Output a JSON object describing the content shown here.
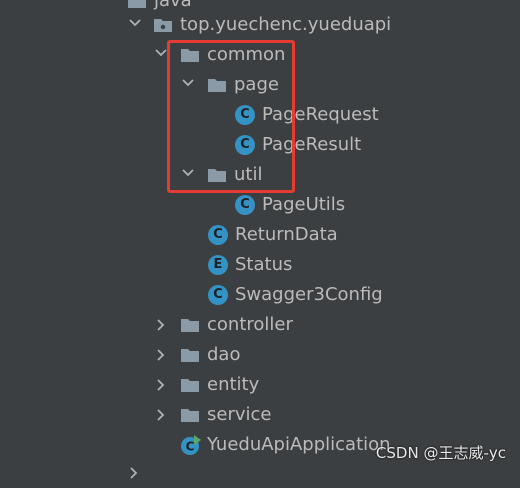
{
  "tree": {
    "java": "java",
    "package": "top.yuechenc.yueduapi",
    "common": "common",
    "page": "page",
    "page_request": "PageRequest",
    "page_result": "PageResult",
    "util": "util",
    "page_utils": "PageUtils",
    "return_data": "ReturnData",
    "status": "Status",
    "swagger": "Swagger3Config",
    "controller": "controller",
    "dao": "dao",
    "entity": "entity",
    "service": "service",
    "app": "YueduApiApplication"
  },
  "icons": {
    "class_letter": "C",
    "enum_letter": "E"
  },
  "watermark": "CSDN @王志威-yc",
  "colors": {
    "background": "#3c3f41",
    "text": "#bbbbbb",
    "class_icon": "#3592c4",
    "highlight": "#e53b32"
  }
}
